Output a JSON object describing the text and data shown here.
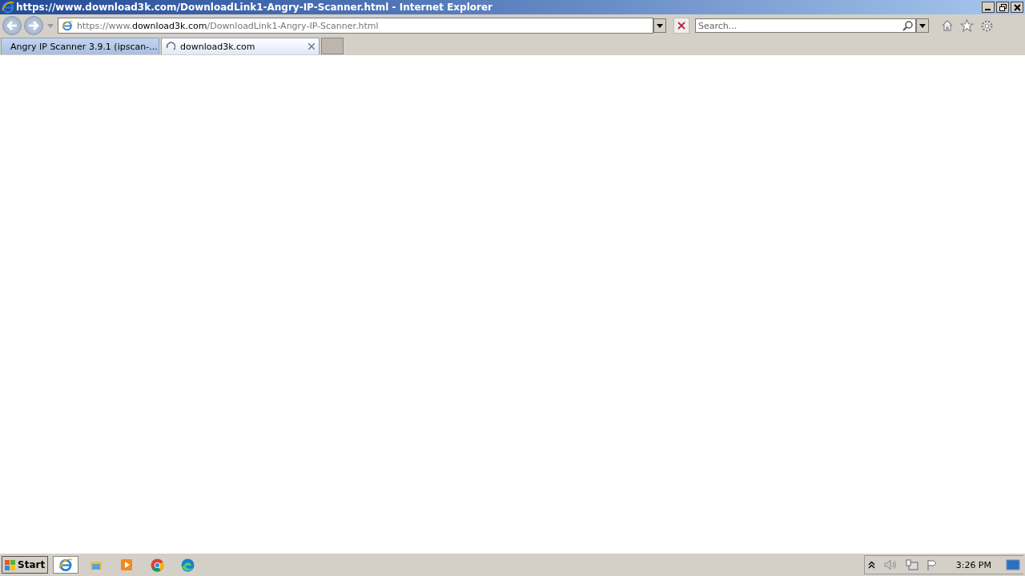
{
  "window": {
    "title": "https://www.download3k.com/DownloadLink1-Angry-IP-Scanner.html - Internet Explorer"
  },
  "address_bar": {
    "value": "https://www.**download3k.com**/DownloadLink1-Angry-IP-Scanner.html"
  },
  "search": {
    "placeholder": "Search..."
  },
  "tabs": [
    {
      "label": "Angry IP Scanner 3.9.1 (ipscan-...",
      "selected": false,
      "kind": "site"
    },
    {
      "label": "download3k.com",
      "selected": true,
      "kind": "loading"
    }
  ],
  "taskbar": {
    "start": "Start",
    "apps": [
      {
        "kind": "ie",
        "selected": true
      },
      {
        "kind": "explorer",
        "selected": false
      },
      {
        "kind": "media",
        "selected": false
      },
      {
        "kind": "chrome",
        "selected": false
      },
      {
        "kind": "edge",
        "selected": false
      }
    ],
    "clock": "3:26 PM"
  }
}
